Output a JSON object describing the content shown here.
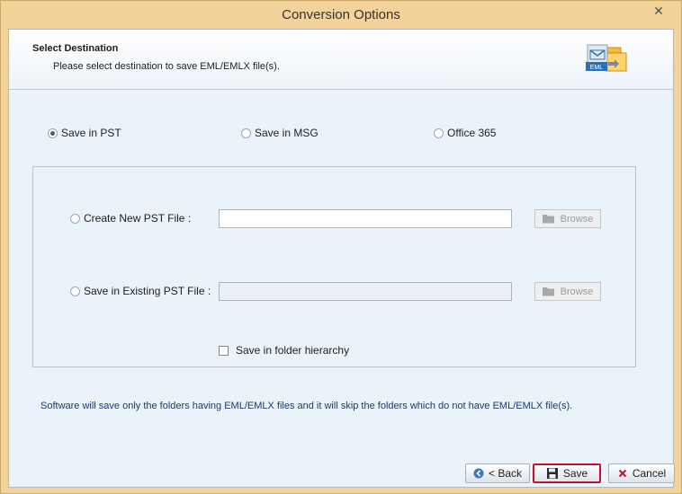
{
  "window": {
    "title": "Conversion Options"
  },
  "header": {
    "title": "Select Destination",
    "subtitle": "Please select destination to save EML/EMLX file(s).",
    "logo_text": "EML"
  },
  "save_options": [
    {
      "label": "Save in PST",
      "checked": true
    },
    {
      "label": "Save in MSG",
      "checked": false
    },
    {
      "label": "Office 365",
      "checked": false
    }
  ],
  "pst_group": {
    "create_new_label": "Create New PST File :",
    "create_new_value": "",
    "existing_label": "Save in Existing PST File :",
    "existing_value": "",
    "browse_label": "Browse",
    "hierarchy_label": "Save in folder hierarchy"
  },
  "note": "Software will save only the folders having EML/EMLX files and it will skip the folders which do not have EML/EMLX file(s).",
  "buttons": {
    "back": "< Back",
    "save": "Save",
    "cancel": "Cancel"
  },
  "colors": {
    "accent_border": "#c8102e",
    "frame": "#f3d39a"
  }
}
